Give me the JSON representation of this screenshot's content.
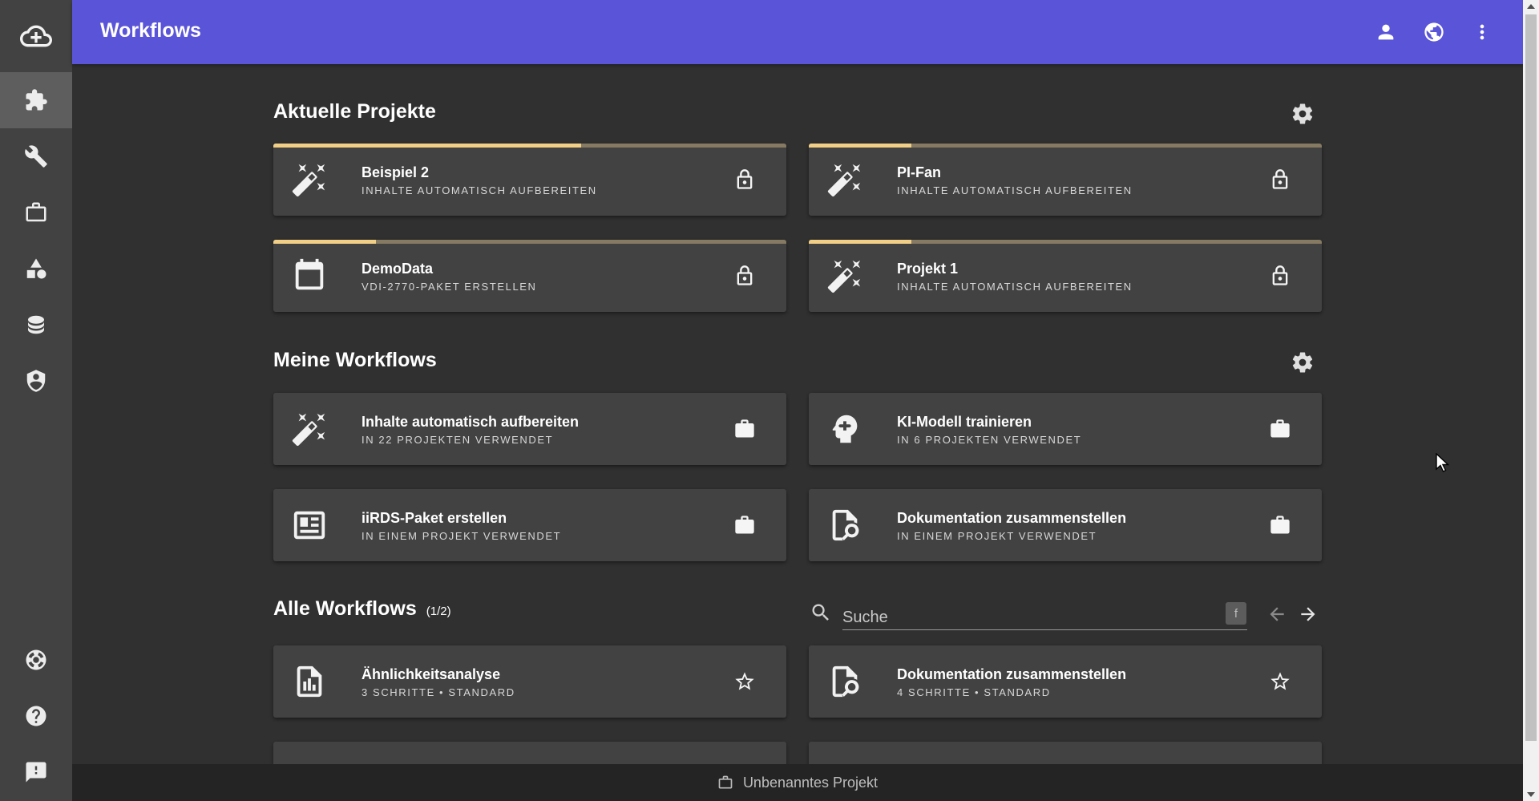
{
  "header": {
    "title": "Workflows",
    "bg_color": "#5a54d9",
    "icons": [
      "account-icon",
      "globe-icon",
      "more-vertical-icon"
    ]
  },
  "sidebar": {
    "logo": "cloud-upload-icon",
    "items": [
      {
        "icon": "puzzle-icon",
        "active": true
      },
      {
        "icon": "wrench-icon",
        "active": false
      },
      {
        "icon": "briefcase-icon",
        "active": false
      },
      {
        "icon": "shapes-icon",
        "active": false
      },
      {
        "icon": "database-icon",
        "active": false
      },
      {
        "icon": "shield-account-icon",
        "active": false
      }
    ],
    "bottom_items": [
      "lifebuoy-icon",
      "help-circle-icon",
      "feedback-icon"
    ]
  },
  "sections": {
    "current_projects": {
      "title": "Aktuelle Projekte"
    },
    "my_workflows": {
      "title": "Meine Workflows"
    },
    "all_workflows": {
      "title": "Alle Workflows",
      "count": "(1/2)"
    }
  },
  "current_projects": [
    {
      "title": "Beispiel 2",
      "subtitle": "Inhalte automatisch aufbereiten",
      "icon": "magic-wand-icon",
      "progress": 0.6,
      "action": "lock-icon"
    },
    {
      "title": "PI-Fan",
      "subtitle": "Inhalte automatisch aufbereiten",
      "icon": "magic-wand-icon",
      "progress": 0.2,
      "action": "lock-icon"
    },
    {
      "title": "DemoData",
      "subtitle": "VDI-2770-Paket erstellen",
      "icon": "calendar-icon",
      "progress": 0.2,
      "action": "lock-icon"
    },
    {
      "title": "Projekt 1",
      "subtitle": "Inhalte automatisch aufbereiten",
      "icon": "magic-wand-icon",
      "progress": 0.2,
      "action": "lock-icon"
    }
  ],
  "my_workflows": [
    {
      "title": "Inhalte automatisch aufbereiten",
      "subtitle": "In 22 Projekten verwendet",
      "icon": "magic-wand-icon",
      "action": "briefcase-icon"
    },
    {
      "title": "KI-Modell trainieren",
      "subtitle": "In 6 Projekten verwendet",
      "icon": "brain-icon",
      "action": "briefcase-icon"
    },
    {
      "title": "iiRDS-Paket erstellen",
      "subtitle": "In einem Projekt verwendet",
      "icon": "newspaper-icon",
      "action": "briefcase-icon"
    },
    {
      "title": "Dokumentation zusammenstellen",
      "subtitle": "In einem Projekt verwendet",
      "icon": "file-search-icon",
      "action": "briefcase-icon"
    }
  ],
  "all_workflows": [
    {
      "title": "Ähnlichkeitsanalyse",
      "subtitle": "3 Schritte • Standard",
      "icon": "file-chart-icon",
      "action": "star-outline-icon"
    },
    {
      "title": "Dokumentation zusammenstellen",
      "subtitle": "4 Schritte • Standard",
      "icon": "file-search-icon",
      "action": "star-outline-icon"
    }
  ],
  "search": {
    "placeholder": "Suche",
    "filter_label": "f"
  },
  "bottom_bar": {
    "label": "Unbenanntes Projekt"
  },
  "colors": {
    "progress_fill": "#f1cf86",
    "progress_track": "#867a62",
    "card_bg": "#424242",
    "page_bg": "#303030"
  }
}
